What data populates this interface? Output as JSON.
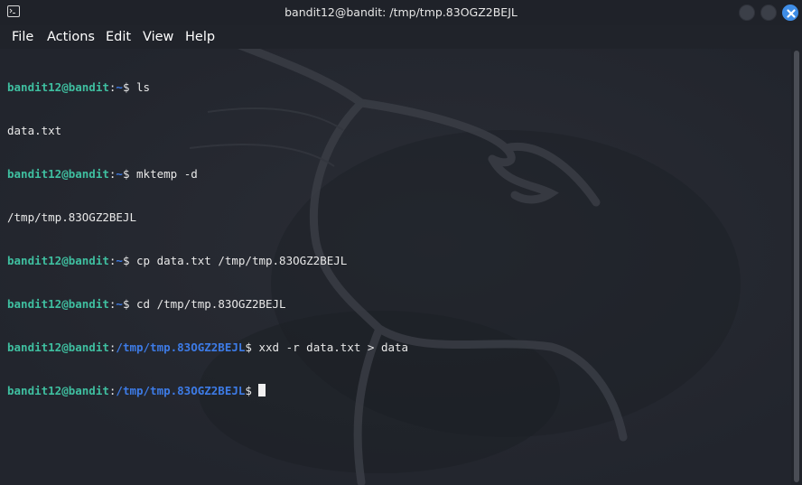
{
  "window": {
    "title": "bandit12@bandit: /tmp/tmp.83OGZ2BEJL",
    "accent_color": "#3f8de6"
  },
  "menu": [
    "File",
    "Actions",
    "Edit",
    "View",
    "Help"
  ],
  "terminal": {
    "prompt_user": "bandit12@bandit",
    "lines": [
      {
        "type": "prompt",
        "path": "~",
        "command": "ls"
      },
      {
        "type": "output",
        "text": "data.txt"
      },
      {
        "type": "prompt",
        "path": "~",
        "command": "mktemp -d"
      },
      {
        "type": "output",
        "text": "/tmp/tmp.83OGZ2BEJL"
      },
      {
        "type": "prompt",
        "path": "~",
        "command": "cp data.txt /tmp/tmp.83OGZ2BEJL"
      },
      {
        "type": "prompt",
        "path": "~",
        "command": "cd /tmp/tmp.83OGZ2BEJL"
      },
      {
        "type": "prompt",
        "path": "/tmp/tmp.83OGZ2BEJL",
        "command": "xxd -r data.txt > data"
      },
      {
        "type": "prompt",
        "path": "/tmp/tmp.83OGZ2BEJL",
        "command": "",
        "cursor": true
      }
    ]
  },
  "icons": {
    "app": "terminal-icon",
    "close": "close-icon",
    "background": "kali-dragon-logo"
  }
}
